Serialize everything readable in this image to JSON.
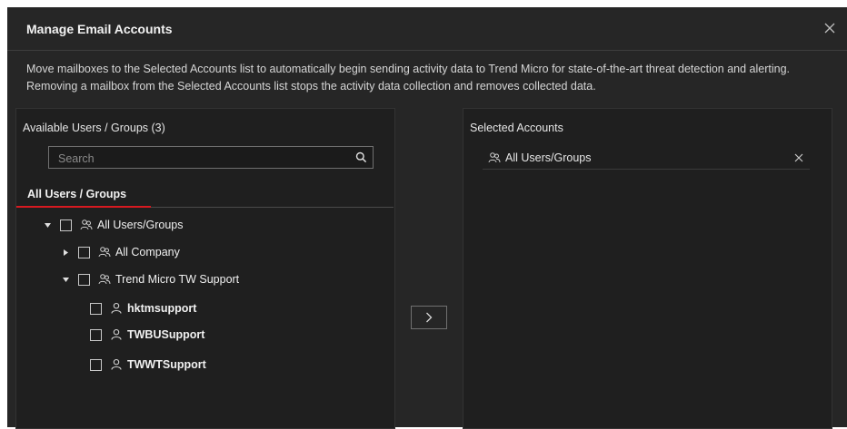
{
  "dialog": {
    "title": "Manage Email Accounts",
    "description": "Move mailboxes to the Selected Accounts list to automatically begin sending activity data to Trend Micro for state-of-the-art threat detection and alerting. Removing a mailbox from the Selected Accounts list stops the activity data collection and removes collected data."
  },
  "available": {
    "title": "Available Users / Groups (3)",
    "search_placeholder": "Search",
    "tab_label": "All Users / Groups",
    "tree": [
      {
        "label": "All Users/Groups",
        "caret": "expanded",
        "icon": "group-icon"
      },
      {
        "label": "All Company",
        "caret": "collapsed",
        "icon": "group-icon"
      },
      {
        "label": "Trend Micro TW Support",
        "caret": "expanded",
        "icon": "group-icon"
      },
      {
        "label": "hktmsupport",
        "caret": "none",
        "icon": "user-icon"
      },
      {
        "label": "TWBUSupport",
        "caret": "none",
        "icon": "user-icon"
      },
      {
        "label": "TWWTSupport",
        "caret": "none",
        "icon": "user-icon"
      }
    ]
  },
  "selected": {
    "title": "Selected Accounts",
    "items": [
      {
        "label": "All Users/Groups",
        "icon": "group-icon"
      }
    ]
  },
  "colors": {
    "background": "#262626",
    "panel": "#1f1f1f",
    "accent": "#d71920"
  }
}
